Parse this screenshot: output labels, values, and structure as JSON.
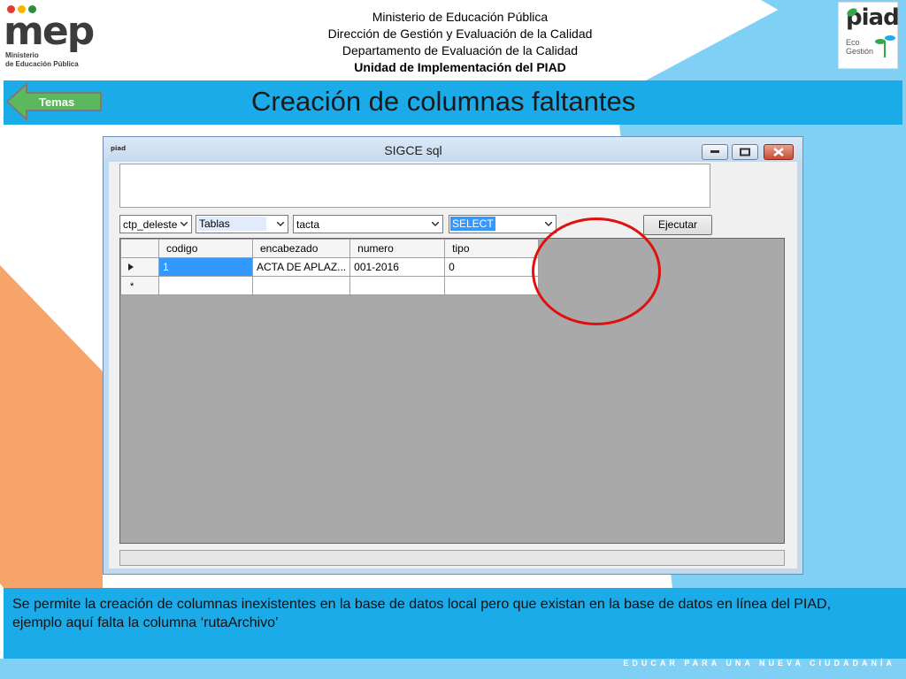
{
  "header": {
    "lines": [
      "Ministerio de Educación Pública",
      "Dirección de Gestión y Evaluación de la Calidad",
      "Departamento de Evaluación de la Calidad",
      "Unidad de Implementación del PIAD"
    ]
  },
  "logos": {
    "mep": {
      "word": "mep",
      "sub_line1": "Ministerio",
      "sub_line2": "de Educación Pública"
    },
    "piad": {
      "word": "piad",
      "eco_line1": "Eco",
      "eco_line2": "Gestión"
    }
  },
  "title_bar": {
    "back_button_label": "Temas",
    "title": "Creación de columnas faltantes"
  },
  "window": {
    "title": "SIGCE sql",
    "app_icon_text": "piad",
    "toolbar": {
      "database_combo": "ctp_deleste",
      "objects_combo": "Tablas",
      "table_combo": "tacta",
      "command_combo": "SELECT",
      "execute_button": "Ejecutar"
    },
    "grid": {
      "columns": [
        "codigo",
        "encabezado",
        "numero",
        "tipo"
      ],
      "rows": [
        [
          "1",
          "ACTA DE APLAZ...",
          "001-2016",
          "0"
        ]
      ],
      "new_row_marker": "*"
    }
  },
  "note": {
    "text": "Se permite la creación de columnas inexistentes en la base de datos local pero que existan en la base de datos en línea del PIAD, ejemplo aquí falta la columna ‘rutaArchivo’"
  },
  "footer": {
    "slogan": "EDUCAR PARA UNA NUEVA CIUDADANÍA"
  },
  "colors": {
    "accent_blue": "#1aabe8",
    "light_blue": "#7fd0f4",
    "orange": "#f7a46b",
    "highlight_circle": "#e01010",
    "selection_blue": "#3399ff"
  }
}
